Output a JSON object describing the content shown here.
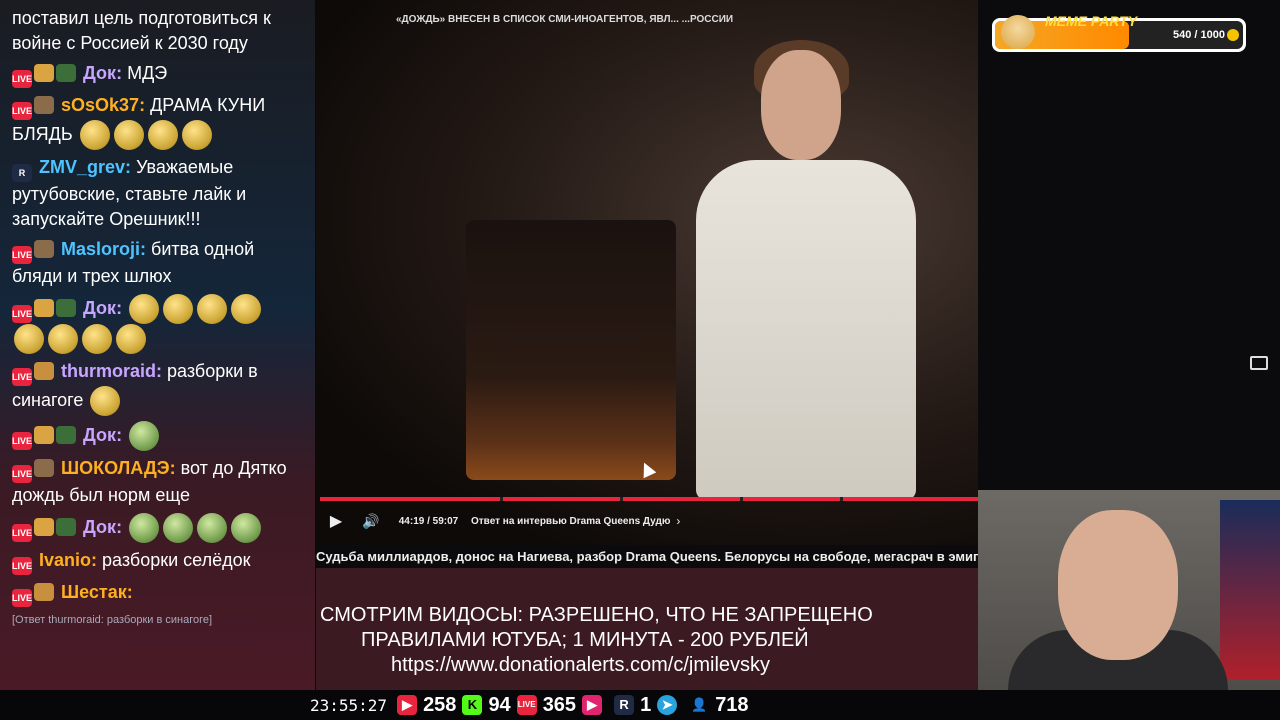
{
  "chat": {
    "top_fragment": "поставил цель подготовиться к войне с Россией к 2030 году",
    "messages": [
      {
        "user": "Док:",
        "text": "МДЭ",
        "color": "#c8a6ff"
      },
      {
        "user": "sOsOk37:",
        "text": "ДРАМА КУНИ БЛЯДЬ",
        "color": "#ffb020"
      },
      {
        "user": "ZMV_grev:",
        "text": "Уважаемые рутубовские, ставьте лайк и запускайте Орешник!!!",
        "color": "#4fc3ff"
      },
      {
        "user": "Masloroji:",
        "text": "битва одной бляди и трех шлюх",
        "color": "#4fc3ff"
      },
      {
        "user": "Док:",
        "text": "",
        "color": "#c8a6ff"
      },
      {
        "user": "thurmoraid:",
        "text": "разборки в синагоге",
        "color": "#c8a6ff"
      },
      {
        "user": "Док:",
        "text": "",
        "color": "#c8a6ff"
      },
      {
        "user": "ШОКОЛАДЭ:",
        "text": "вот до Дятко дождь был норм еще",
        "color": "#ffb020"
      },
      {
        "user": "Док:",
        "text": "",
        "color": "#c8a6ff"
      },
      {
        "user": "Ivanio:",
        "text": "разборки селёдок",
        "color": "#ffb020"
      },
      {
        "user": "Шестак:",
        "text": "",
        "color": "#ffb020"
      }
    ],
    "reply_hint": "[Ответ thurmoraid: разборки в синагоге]"
  },
  "stats": {
    "time": "23:55:27",
    "youtube": "258",
    "kick": "94",
    "vk_live": "365",
    "trovo": "",
    "rutube": "1",
    "telegram": "",
    "viewers": "718"
  },
  "video": {
    "ticker": "«ДОЖДЬ» ВНЕСЕН В СПИСОК СМИ-ИНОАГЕНТОВ, ЯВЛ... ...РОССИИ",
    "time": "44:19 / 59:07",
    "chapter": "Ответ на интервью Drama Queens Дудю",
    "title": "Судьба миллиардов, донос на Нагиева, разбор Drama Queens. Белорусы на свободе, мегасрач в эмигр"
  },
  "info": {
    "line1": "СМОТРИМ ВИДОСЫ: РАЗРЕШЕНО, ЧТО НЕ ЗАПРЕЩЕНО",
    "line2": "ПРАВИЛАМИ ЮТУБА; 1 МИНУТА - 200 РУБЛЕЙ",
    "line3": "https://www.donationalerts.com/c/jmilevsky"
  },
  "meme_party": {
    "label": "MEME PARTY",
    "counter": "540 / 1000",
    "progress": 0.54
  },
  "colors": {
    "live_red": "#e8243e",
    "info_bg": "#3b1a22",
    "progress": "#e8243e"
  },
  "icons": [
    "live-badge",
    "play-icon",
    "volume-icon",
    "chevron-right-icon",
    "pip-icon",
    "youtube-icon",
    "kick-icon",
    "vk-live-icon",
    "trovo-icon",
    "rutube-icon",
    "telegram-icon",
    "viewers-icon"
  ]
}
